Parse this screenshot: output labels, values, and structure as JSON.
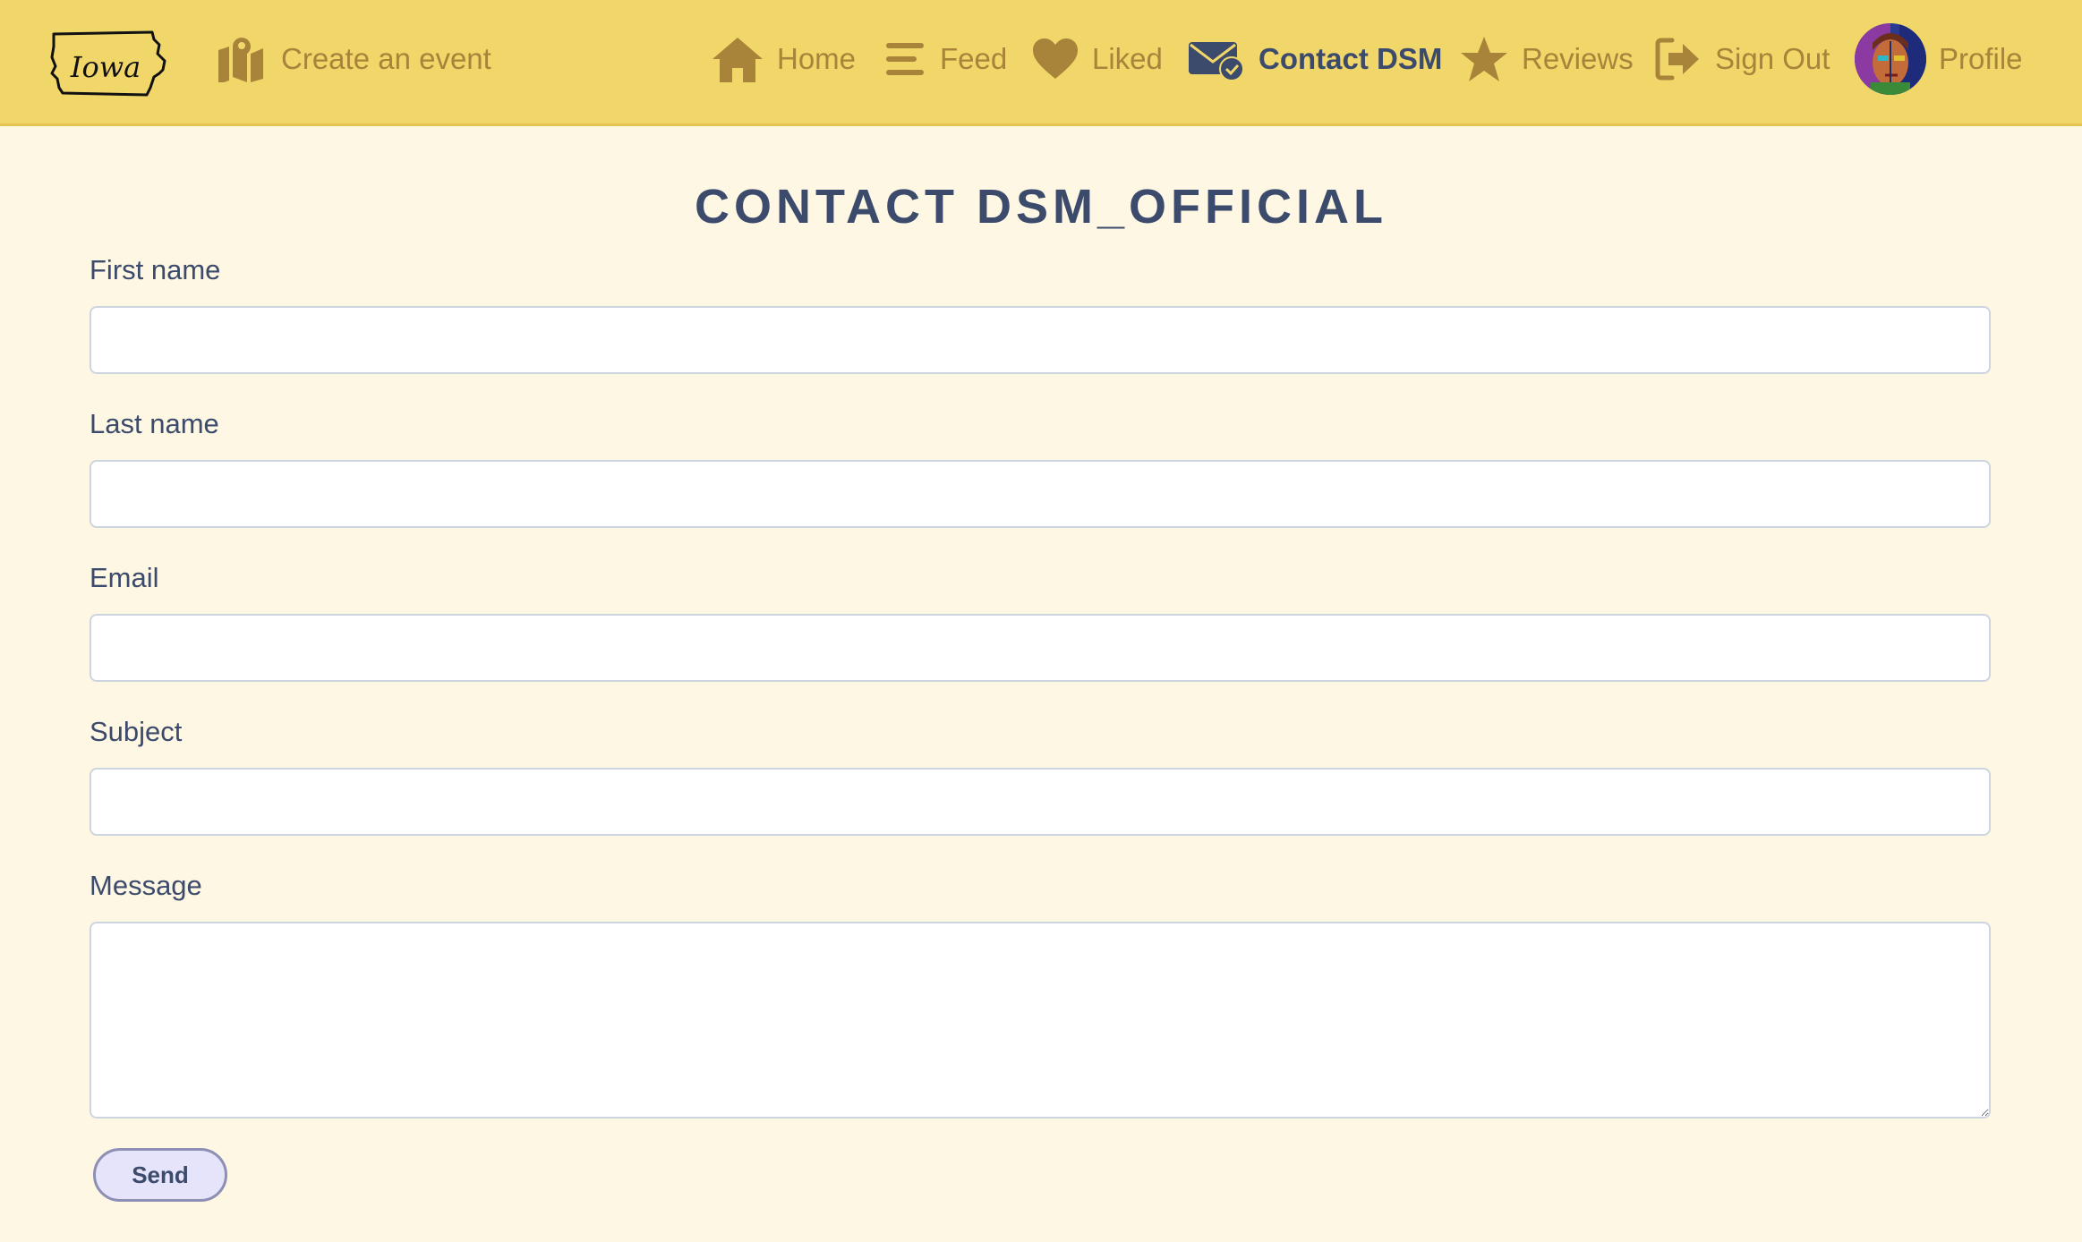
{
  "brand": {
    "logo_text": "Iowa"
  },
  "nav": {
    "create_event": "Create an event",
    "home": "Home",
    "feed": "Feed",
    "liked": "Liked",
    "contact": "Contact DSM",
    "reviews": "Reviews",
    "sign_out": "Sign Out",
    "profile": "Profile",
    "active_item": "Contact DSM"
  },
  "page": {
    "title": "CONTACT DSM_OFFICIAL"
  },
  "form": {
    "first_name": {
      "label": "First name",
      "value": ""
    },
    "last_name": {
      "label": "Last name",
      "value": ""
    },
    "email": {
      "label": "Email",
      "value": ""
    },
    "subject": {
      "label": "Subject",
      "value": ""
    },
    "message": {
      "label": "Message",
      "value": ""
    },
    "send_label": "Send"
  },
  "colors": {
    "navbar_bg": "#f1d76a",
    "nav_icon": "#a8843a",
    "active_text": "#3c4a6b",
    "page_bg": "#fdf7e4",
    "button_bg": "#e6e4fb",
    "button_border": "#8d8fb4"
  },
  "icons": {
    "create_event": "map-marker-icon",
    "home": "home-icon",
    "feed": "menu-lines-icon",
    "liked": "heart-icon",
    "contact": "envelope-check-icon",
    "reviews": "star-icon",
    "sign_out": "sign-out-icon"
  }
}
